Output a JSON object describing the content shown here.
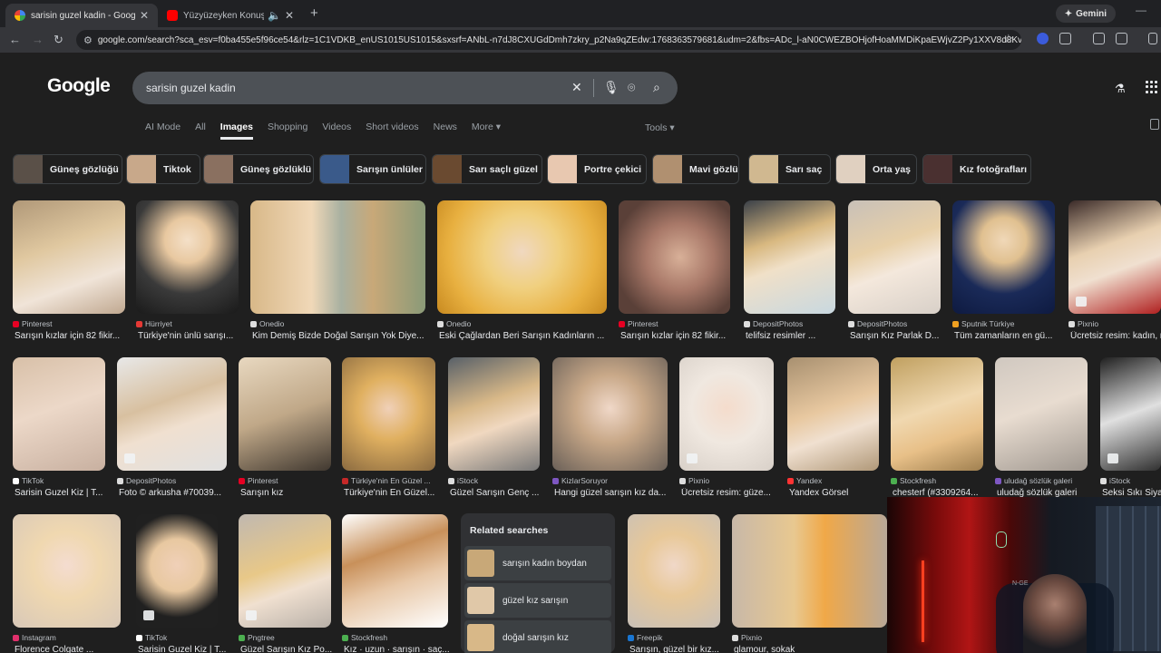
{
  "browser": {
    "tabs": [
      {
        "title": "sarisin guzel kadin - Google Se",
        "active": true
      },
      {
        "title": "Yüzyüzeyken Konuşuruz - D",
        "active": false
      }
    ],
    "gemini_label": "Gemini",
    "url": "google.com/search?sca_esv=f0ba455e5f96ce54&rlz=1C1VDKB_enUS1015US1015&sxsrf=ANbL-n7dJ8CXUGdDmh7zkry_p2Na9qZEdw:1768363579681&udm=2&fbs=ADc_l-aN0CWEZBOHjofHoaMMDiKpaEWjvZ2Py1XXV8d8KvlI3o..."
  },
  "google": {
    "logo": "Google",
    "query": "sarisin guzel kadin",
    "nav_tabs": [
      "AI Mode",
      "All",
      "Images",
      "Shopping",
      "Videos",
      "Short videos",
      "News",
      "More ▾"
    ],
    "active_tab": "Images",
    "tools_label": "Tools ▾"
  },
  "chips": [
    {
      "label": "Güneş gözlüğü",
      "color": "#5a5048"
    },
    {
      "label": "Tiktok",
      "color": "#c8a88a"
    },
    {
      "label": "Güneş gözlüklü",
      "color": "#8a7060"
    },
    {
      "label": "Sarışın ünlüler",
      "color": "#3a5a8a"
    },
    {
      "label": "Sarı saçlı güzel",
      "color": "#6a4a30"
    },
    {
      "label": "Portre çekici",
      "color": "#e8c8b0"
    },
    {
      "label": "Mavi gözlü",
      "color": "#b09070"
    },
    {
      "label": "Sarı saç",
      "color": "#d0b890"
    },
    {
      "label": "Orta yaş",
      "color": "#e0d0c0"
    },
    {
      "label": "Kız fotoğrafları",
      "color": "#4a3030"
    }
  ],
  "results_row1": [
    {
      "source": "Pinterest",
      "caption": "Sarışın kızlar için 82 fikir...",
      "src_color": "#e60023",
      "bg": "linear-gradient(160deg,#b09878 0%,#e0c8a0 40%,#f0e4d8 70%,#c0a890 100%)"
    },
    {
      "source": "Hürriyet",
      "caption": "Türkiye'nin ünlü sarışı...",
      "src_color": "#e53935",
      "bg": "radial-gradient(circle at 50% 35%,#f4e0c8 0%,#e8c8a0 25%,#3a3a3a 60%,#1a1a1a 100%)"
    },
    {
      "source": "Onedio",
      "caption": "Kim Demiş Bizde Doğal Sarışın Yok Diye...",
      "src_color": "#dddddd",
      "bg": "linear-gradient(90deg,#d8b888 0%,#f0d8b8 35%,#a8b0a0 52%,#c8a878 70%,#8a9a78 100%)"
    },
    {
      "source": "Onedio",
      "caption": "Eski Çağlardan Beri Sarışın Kadınların ...",
      "src_color": "#dddddd",
      "bg": "radial-gradient(circle at 50% 45%,#f0d8c0 0%,#f0d080 35%,#e8b040 70%,#c88a20 100%)"
    },
    {
      "source": "Pinterest",
      "caption": "Sarışın kızlar için 82 fikir...",
      "src_color": "#e60023",
      "bg": "radial-gradient(circle at 55% 50%,#d8b098 0%,#a87868 40%,#5a4038 80%)"
    },
    {
      "source": "DepositPhotos",
      "caption": "telifsiz resimler ...",
      "src_color": "#dddddd",
      "bg": "linear-gradient(160deg,#3a4048 0%,#d8b880 35%,#f0e0c8 55%,#c8d8e0 100%)"
    },
    {
      "source": "DepositPhotos",
      "caption": "Sarışın Kız Parlak D...",
      "src_color": "#dddddd",
      "bg": "linear-gradient(160deg,#c8c0b8 0%,#e8d0a8 40%,#f4e8dc 60%,#d8d0c8 100%)"
    },
    {
      "source": "Sputnik Türkiye",
      "caption": "Tüm zamanların en gü...",
      "src_color": "#f0a020",
      "bg": "radial-gradient(circle at 50% 35%,#f0d8b8 0%,#e0c090 25%,#1a2a58 60%,#0e1a40 100%)"
    },
    {
      "source": "Pixnio",
      "caption": "Ücretsiz resim: kadın, m...",
      "src_color": "#dddddd",
      "bg": "linear-gradient(160deg,#3a2a28 0%,#e8d0b0 40%,#f0e0d0 60%,#b02020 100%)"
    }
  ],
  "results_row2": [
    {
      "source": "TikTok",
      "caption": "Sarisin Guzel Kiz | T...",
      "src_color": "#ffffff",
      "bg": "linear-gradient(160deg,#d8c0a8 0%,#ecd8c8 45%,#c8b0a0 100%)"
    },
    {
      "source": "DepositPhotos",
      "caption": "Foto © arkusha #70039...",
      "src_color": "#dddddd",
      "bg": "linear-gradient(160deg,#e8e8e8 0%,#d8c0a0 40%,#f0e0d0 60%,#e0e0e0 100%)"
    },
    {
      "source": "Pinterest",
      "caption": "Sarışın kız",
      "src_color": "#e60023",
      "bg": "linear-gradient(160deg,#e8d8c0 0%,#c0a888 50%,#403830 100%)"
    },
    {
      "source": "Türkiye'nin En Güzel ...",
      "caption": "Türkiye'nin En Güzel...",
      "src_color": "#c62828",
      "bg": "radial-gradient(circle at 50% 45%,#f0d0b8 0%,#e0b060 40%,#8a6a40 100%)"
    },
    {
      "source": "iStock",
      "caption": "Güzel Sarışın Genç ...",
      "src_color": "#dddddd",
      "bg": "linear-gradient(160deg,#586068 0%,#d8b888 40%,#f0d8c0 60%,#787878 100%)"
    },
    {
      "source": "KizlarSoruyor",
      "caption": "Hangi güzel sarışın kız da...",
      "src_color": "#7e57c2",
      "bg": "radial-gradient(circle at 50% 45%,#f0d8c8 0%,#c8a888 40%,#6a6058 100%)"
    },
    {
      "source": "Pixnio",
      "caption": "Ücretsiz resim: güze...",
      "src_color": "#dddddd",
      "bg": "radial-gradient(circle at 50% 45%,#f4dccc 0%,#f0e8e0 45%,#d8d0c8 100%)"
    },
    {
      "source": "Yandex",
      "caption": "Yandex Görsel",
      "src_color": "#ff3333",
      "bg": "linear-gradient(160deg,#a89070 0%,#e8c8a0 45%,#f0e0d0 65%,#b09878 100%)"
    },
    {
      "source": "Stockfresh",
      "caption": "chesterf (#3309264...",
      "src_color": "#4caf50",
      "bg": "linear-gradient(160deg,#c0a060 0%,#f0d8b0 45%,#e8c088 70%,#a08050 100%)"
    },
    {
      "source": "uludağ sözlük galeri",
      "caption": "uludağ sözlük galeri",
      "src_color": "#7e57c2",
      "bg": "linear-gradient(160deg,#d0c8c0 0%,#e8dcd0 45%,#a09890 100%)"
    },
    {
      "source": "iStock",
      "caption": "Seksi Sıkı Siyah",
      "src_color": "#dddddd",
      "bg": "linear-gradient(160deg,#202020 0%,#e0e0e0 50%,#303030 100%)"
    }
  ],
  "results_row3": [
    {
      "source": "Instagram",
      "caption": "Florence Colgate ...",
      "src_color": "#e1306c",
      "bg": "radial-gradient(circle at 50% 45%,#f4dcd0 0%,#f0d8b0 40%,#d8c8b8 100%)"
    },
    {
      "source": "TikTok",
      "caption": "Sarisin Guzel Kiz | T...",
      "src_color": "#ffffff",
      "bg": "radial-gradient(circle at 50% 45%,#f0d0b8 0%,#e8c8a0 35%,#202020 70%)"
    },
    {
      "source": "Pngtree",
      "caption": "Güzel Sarışın Kız Po...",
      "src_color": "#4caf50",
      "bg": "linear-gradient(160deg,#c0b8b0 0%,#e8c888 45%,#f0e0d0 65%,#b8b0a8 100%)"
    },
    {
      "source": "Stockfresh",
      "caption": "Kız · uzun · sarışın · saç...",
      "src_color": "#4caf50",
      "bg": "linear-gradient(160deg,#ffffff 0%,#c8905a 35%,#e8c8a8 60%,#ffffff 100%)"
    },
    {
      "source": "Freepik",
      "caption": "Sarışın, güzel bir kız...",
      "src_color": "#1976d2",
      "bg": "radial-gradient(circle at 50% 45%,#f0d8c8 0%,#e8c898 40%,#c8c0b8 100%)"
    },
    {
      "source": "Pixnio",
      "caption": "glamour, sokak",
      "src_color": "#dddddd",
      "bg": "linear-gradient(90deg,#c8b8a8 0%,#e8c890 40%,#f0a848 60%,#b8a898 100%)"
    }
  ],
  "related": {
    "heading": "Related searches",
    "items": [
      {
        "label": "sarışın kadın boydan",
        "thumb": "#c8a878"
      },
      {
        "label": "güzel kız sarışın",
        "thumb": "#e0c8a8"
      },
      {
        "label": "doğal sarışın kız",
        "thumb": "#d8b888"
      }
    ]
  },
  "webcam": {
    "brand": "N-GE"
  }
}
